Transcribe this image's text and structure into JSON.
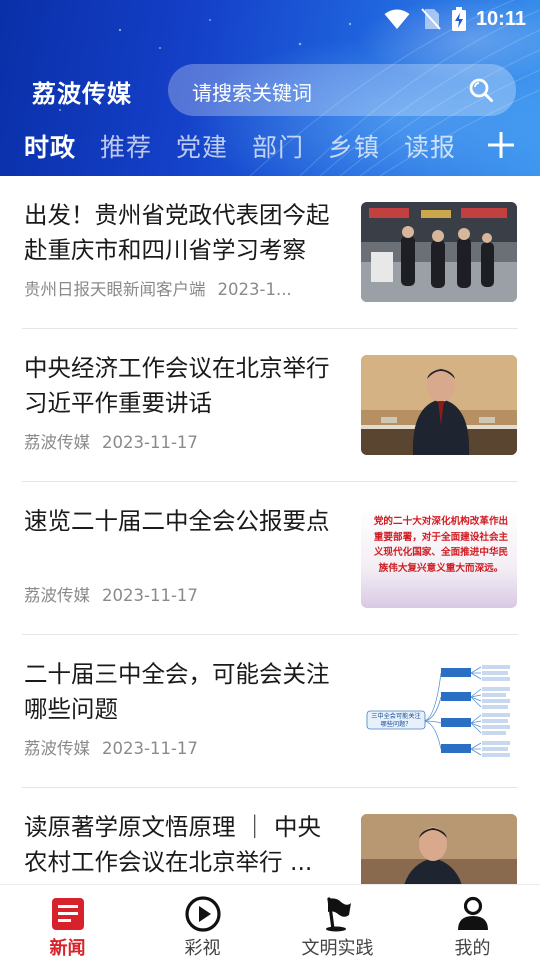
{
  "status_bar": {
    "time": "10:11"
  },
  "header": {
    "app_title": "荔波传媒",
    "search_placeholder": "请搜索关键词",
    "tabs": [
      {
        "label": "时政",
        "active": true
      },
      {
        "label": "推荐",
        "active": false
      },
      {
        "label": "党建",
        "active": false
      },
      {
        "label": "部门",
        "active": false
      },
      {
        "label": "乡镇",
        "active": false
      },
      {
        "label": "读报",
        "active": false
      }
    ]
  },
  "news": [
    {
      "title": "出发！贵州省党政代表团今起赴重庆市和四川省学习考察",
      "source": "贵州日报天眼新闻客户端",
      "date": "2023-1..."
    },
    {
      "title": "中央经济工作会议在北京举行习近平作重要讲话",
      "source": "荔波传媒",
      "date": "2023-11-17"
    },
    {
      "title": "速览二十届二中全会公报要点",
      "source": "荔波传媒",
      "date": "2023-11-17",
      "thumb_text": "党的二十大对深化机构改革作出重要部署，对于全面建设社会主义现代化国家、全面推进中华民族伟大复兴意义重大而深远。"
    },
    {
      "title": "二十届三中全会，可能会关注哪些问题",
      "source": "荔波传媒",
      "date": "2023-11-17",
      "thumb_text": "三中全会可能关注哪些问题？"
    },
    {
      "title": "读原著学原文悟原理 ｜ 中央农村工作会议在北京举行 ...",
      "source": "",
      "date": ""
    }
  ],
  "bottom_nav": [
    {
      "label": "新闻",
      "icon": "news-icon",
      "active": true
    },
    {
      "label": "彩视",
      "icon": "play-icon",
      "active": false
    },
    {
      "label": "文明实践",
      "icon": "flag-icon",
      "active": false
    },
    {
      "label": "我的",
      "icon": "person-icon",
      "active": false
    }
  ],
  "colors": {
    "accent": "#d8222b",
    "header_blue": "#1440c8"
  }
}
